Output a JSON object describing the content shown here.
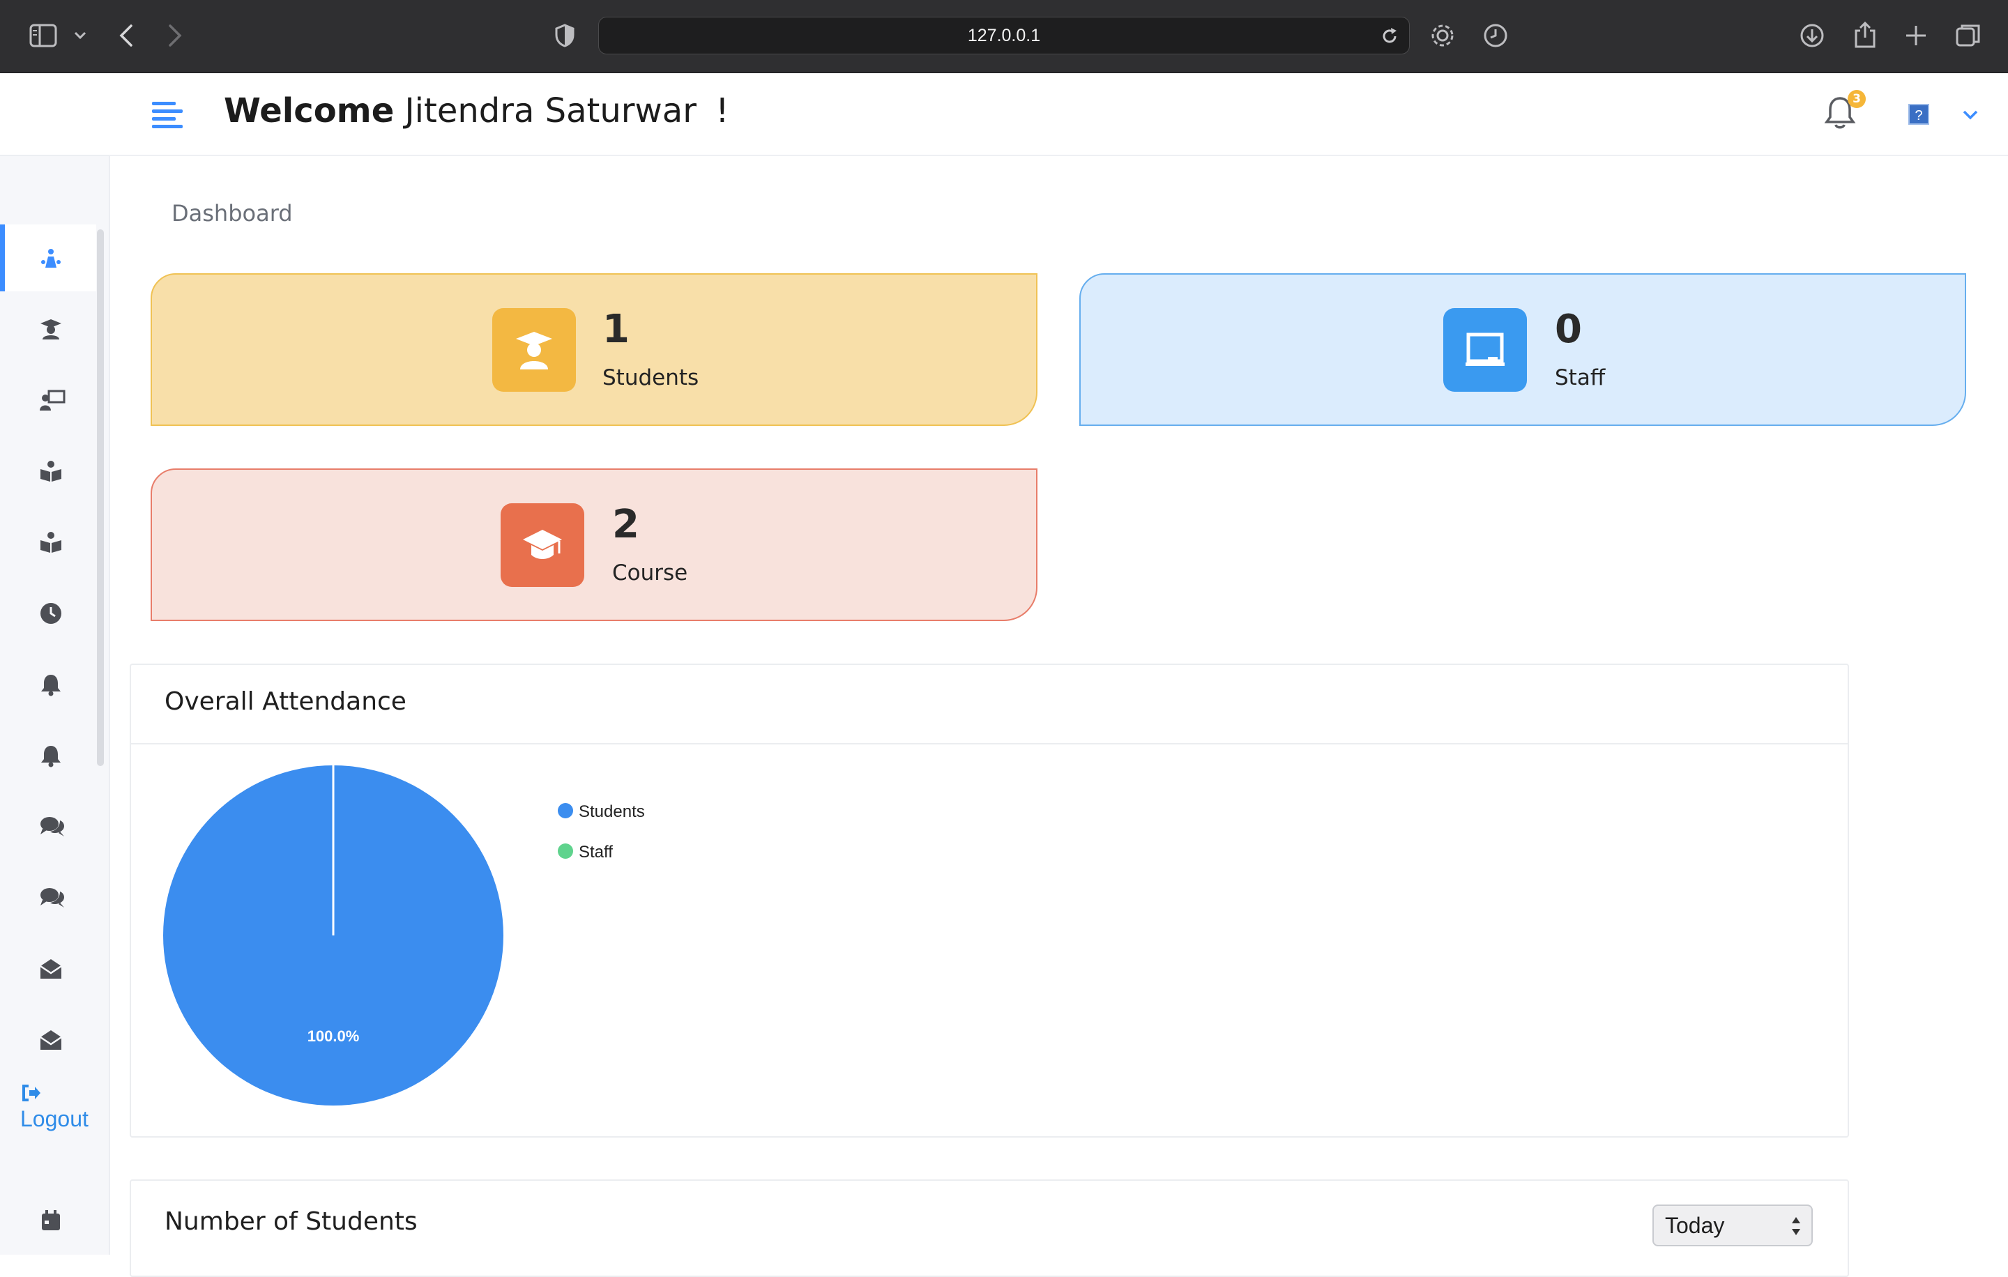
{
  "browser": {
    "url": "127.0.0.1"
  },
  "header": {
    "welcome_bold": "Welcome",
    "user_name": "Jitendra Saturwar",
    "exclaim": "!",
    "notification_count": "3"
  },
  "breadcrumb": "Dashboard",
  "stats": [
    {
      "count": "1",
      "label": "Students",
      "color": "#f3b842"
    },
    {
      "count": "0",
      "label": "Staff",
      "color": "#3a9af0"
    },
    {
      "count": "2",
      "label": "Course",
      "color": "#e8704d"
    }
  ],
  "attendance": {
    "title": "Overall Attendance",
    "slice_label": "100.0%"
  },
  "chart_data": {
    "type": "pie",
    "labels": [
      "Students",
      "Staff"
    ],
    "values": [
      100.0,
      0.0
    ],
    "colors": [
      "#3b8def",
      "#5fd38d"
    ],
    "legend": "right"
  },
  "students_panel": {
    "title": "Number of Students",
    "period_selected": "Today"
  },
  "sidebar": {
    "logout_label": "Logout"
  }
}
